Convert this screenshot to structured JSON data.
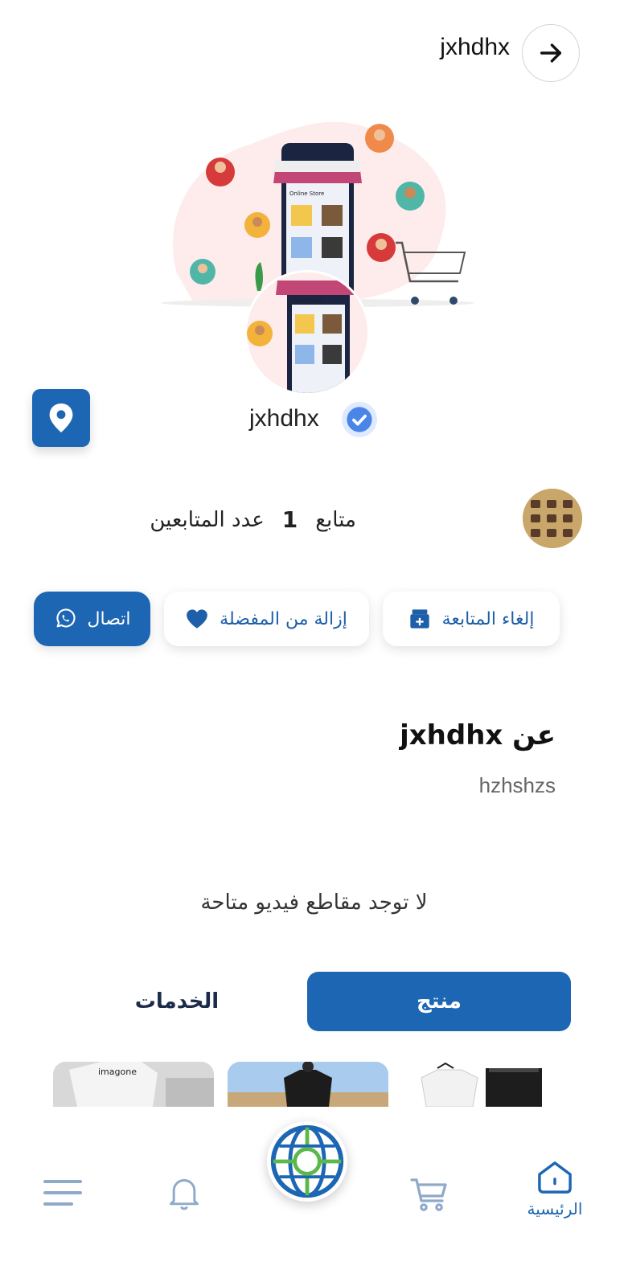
{
  "header": {
    "title": "jxhdhx"
  },
  "banner": {
    "store_label_1": "Online Store",
    "store_label_2": "Online Store"
  },
  "profile": {
    "name": "jxhdhx"
  },
  "followers": {
    "label": "عدد المتابعين",
    "count": "1",
    "unit": "متابع"
  },
  "actions": {
    "unfollow_label": "إلغاء المتابعة",
    "unfavorite_label": "إزالة من المفضلة",
    "call_label": "اتصال"
  },
  "about": {
    "title": "عن jxhdhx",
    "text": "hzhshzs"
  },
  "videos": {
    "empty_text": "لا توجد مقاطع فيديو متاحة"
  },
  "tabs": {
    "product_label": "منتج",
    "services_label": "الخدمات",
    "active": "product"
  },
  "products": [
    {
      "thumb_text": ""
    },
    {
      "thumb_text": ""
    },
    {
      "thumb_text": "imagone"
    }
  ],
  "nav": {
    "home_label": "الرئيسية"
  },
  "colors": {
    "primary": "#1d66b3",
    "accent_green": "#5bb84a",
    "banner_bg": "#fdeceb"
  },
  "icons": {
    "back": "arrow-right-icon",
    "location": "map-pin-icon",
    "verified": "check-badge-icon",
    "unfollow": "store-plus-icon",
    "unfavorite": "heart-icon",
    "call": "whatsapp-icon",
    "home": "home-icon",
    "cart": "cart-icon",
    "center": "globe-target-icon",
    "bell": "bell-icon",
    "menu": "menu-icon"
  }
}
